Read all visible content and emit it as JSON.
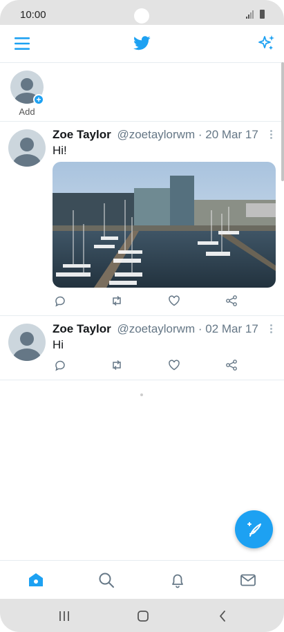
{
  "status_bar": {
    "time": "10:00"
  },
  "app_bar": {
    "menu_icon": "hamburger-menu-icon",
    "logo_icon": "twitter-bird-icon",
    "sparkle_icon": "sparkle-icon",
    "accent": "#1da1f2"
  },
  "fleets": {
    "add_label": "Add"
  },
  "tweets": [
    {
      "name": "Zoe Taylor",
      "handle": "@zoetaylorwm",
      "separator": "·",
      "date": "20 Mar 17",
      "text": "Hi!",
      "has_media": true
    },
    {
      "name": "Zoe Taylor",
      "handle": "@zoetaylorwm",
      "separator": "·",
      "date": "02 Mar 17",
      "text": "Hi",
      "has_media": false
    }
  ],
  "tweet_actions": [
    "reply-icon",
    "retweet-icon",
    "like-icon",
    "share-icon"
  ],
  "bottom_nav": [
    "home-icon",
    "search-icon",
    "notifications-icon",
    "messages-icon"
  ],
  "system_nav": [
    "recent-apps-icon",
    "home-button-icon",
    "back-icon"
  ]
}
